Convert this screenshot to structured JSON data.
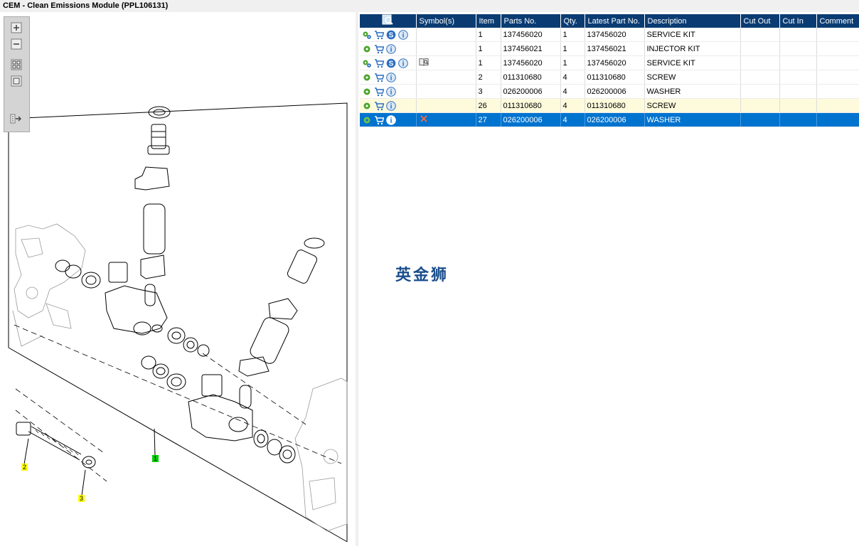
{
  "window": {
    "title": "CEM - Clean Emissions Module (PPL106131)"
  },
  "callouts": {
    "c1": "1",
    "c2": "2",
    "c3": "3"
  },
  "table": {
    "headers": {
      "icons": "",
      "symbols": "Symbol(s)",
      "item": "Item",
      "parts_no": "Parts No.",
      "qty": "Qty.",
      "latest": "Latest Part No.",
      "desc": "Description",
      "cut_out": "Cut Out",
      "cut_in": "Cut In",
      "comment": "Comment"
    },
    "rows": [
      {
        "item": "1",
        "parts_no": "137456020",
        "qty": "1",
        "latest": "137456020",
        "desc": "SERVICE KIT",
        "cut_out": "",
        "cut_in": "",
        "comment": ""
      },
      {
        "item": "1",
        "parts_no": "137456021",
        "qty": "1",
        "latest": "137456021",
        "desc": "INJECTOR KIT",
        "cut_out": "",
        "cut_in": "",
        "comment": ""
      },
      {
        "item": "1",
        "parts_no": "137456020",
        "qty": "1",
        "latest": "137456020",
        "desc": "SERVICE KIT",
        "cut_out": "",
        "cut_in": "",
        "comment": ""
      },
      {
        "item": "2",
        "parts_no": "011310680",
        "qty": "4",
        "latest": "011310680",
        "desc": "SCREW",
        "cut_out": "",
        "cut_in": "",
        "comment": ""
      },
      {
        "item": "3",
        "parts_no": "026200006",
        "qty": "4",
        "latest": "026200006",
        "desc": "WASHER",
        "cut_out": "",
        "cut_in": "",
        "comment": ""
      },
      {
        "item": "26",
        "parts_no": "011310680",
        "qty": "4",
        "latest": "011310680",
        "desc": "SCREW",
        "cut_out": "",
        "cut_in": "",
        "comment": ""
      },
      {
        "item": "27",
        "parts_no": "026200006",
        "qty": "4",
        "latest": "026200006",
        "desc": "WASHER",
        "cut_out": "",
        "cut_in": "",
        "comment": ""
      }
    ]
  },
  "watermark": "英金狮",
  "colors": {
    "header_bg": "#0a3c73",
    "selected_row": "#0073cf",
    "highlight_row": "#fdfbdc",
    "callout_yellow": "#ffff00",
    "callout_green": "#00d000"
  },
  "icons": [
    "zoom-in-icon",
    "zoom-out-icon",
    "fit-icon",
    "actual-size-icon",
    "export-icon",
    "search-table-icon",
    "gear-icon",
    "cart-icon",
    "service-s-icon",
    "info-icon",
    "book-icon",
    "close-x-icon"
  ]
}
